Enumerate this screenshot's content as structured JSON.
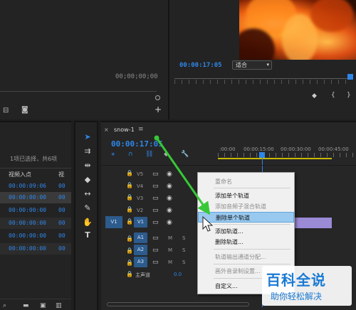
{
  "monitor": {
    "timecode_left": "00;00;00;00",
    "timecode_right": "00:00:17:05",
    "fit_select": "适合"
  },
  "project": {
    "selection_info": "1项已选择，共6项",
    "col_in": "视频入点",
    "col_v": "视",
    "rows": [
      "00:00:09:06",
      "00:00:00:00",
      "00:00:00:00",
      "00:00:00:00",
      "00:00:00:00",
      "00:00:00:00"
    ],
    "rows_right": [
      "00",
      "00",
      "00",
      "00",
      "00",
      "00"
    ]
  },
  "timeline": {
    "tab": "snow-1",
    "timecode": "00:00:17:05",
    "ruler": [
      ":00:00",
      "00:00:15:00",
      "00:00:30:00",
      "00:00:45:00"
    ],
    "video_tracks": [
      "V5",
      "V4",
      "V3",
      "V2",
      "V1"
    ],
    "audio_tracks": [
      "A1",
      "A2",
      "A3"
    ],
    "source_v": "V1",
    "mute": "M",
    "solo": "S",
    "master": "主声道",
    "master_val": "0.0"
  },
  "context_menu": {
    "items": [
      {
        "label": "重命名",
        "enabled": false
      },
      {
        "label": "添加单个轨道",
        "enabled": true
      },
      {
        "label": "添加音频子混合轨道",
        "enabled": false
      },
      {
        "label": "删除单个轨道",
        "enabled": true,
        "highlighted": true
      },
      {
        "label": "添加轨道...",
        "enabled": true
      },
      {
        "label": "删除轨道...",
        "enabled": true
      },
      {
        "label": "轨道输出通道分配...",
        "enabled": false
      },
      {
        "label": "画外音录制设置...",
        "enabled": false
      },
      {
        "label": "自定义...",
        "enabled": true
      }
    ]
  },
  "watermark": {
    "title": "百科全说",
    "subtitle": "助你轻松解决"
  },
  "colors": {
    "accent": "#2f86e8",
    "track_blue": "#2c5b8c",
    "arrow": "#37c837",
    "clip": "#9b8ad6"
  }
}
